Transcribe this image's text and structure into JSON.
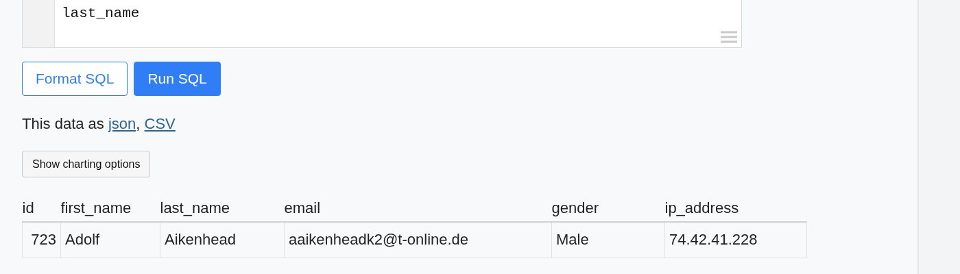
{
  "editor": {
    "code_lines": [
      "last_name"
    ]
  },
  "buttons": [
    {
      "label": "Format SQL",
      "kind": "outline"
    },
    {
      "label": "Run SQL",
      "kind": "primary"
    }
  ],
  "export": {
    "text": "This data as",
    "links": [
      "json",
      "CSV"
    ],
    "separator": ","
  },
  "chart_button": {
    "label": "Show charting options"
  },
  "table": {
    "columns": [
      "id",
      "first_name",
      "last_name",
      "email",
      "gender",
      "ip_address"
    ],
    "rows": [
      [
        "723",
        "Adolf",
        "Aikenhead",
        "aaikenheadk2@t-online.de",
        "Male",
        "74.42.41.228"
      ]
    ]
  }
}
